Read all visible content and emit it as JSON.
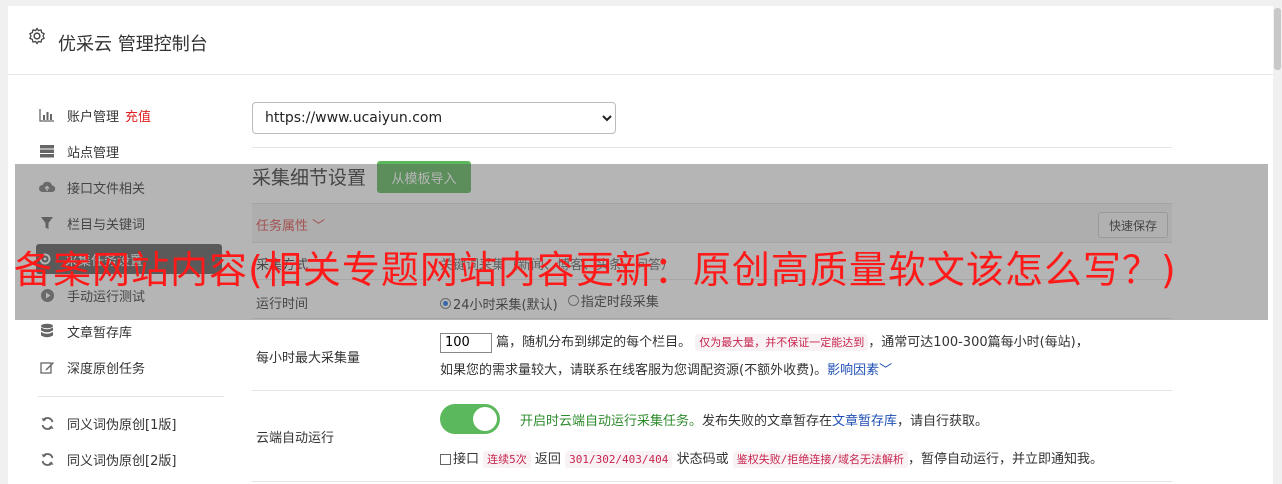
{
  "header": {
    "title": "优采云 管理控制台",
    "icon": "gear-icon"
  },
  "sidebar": {
    "items": [
      {
        "label": "账户管理",
        "icon": "bar-chart-icon",
        "badge": "充值"
      },
      {
        "label": "站点管理",
        "icon": "server-icon"
      },
      {
        "label": "接口文件相关",
        "icon": "cloud-upload-icon"
      },
      {
        "label": "栏目与关键词",
        "icon": "filter-icon"
      },
      {
        "label": "采集任务设置",
        "icon": "settings-icon",
        "active": true
      },
      {
        "label": "手动运行测试",
        "icon": "play-circle-icon"
      },
      {
        "label": "文章暂存库",
        "icon": "database-icon"
      },
      {
        "label": "深度原创任务",
        "icon": "edit-icon"
      },
      {
        "label": "同义词伪原创[1版]",
        "icon": "refresh-icon"
      },
      {
        "label": "同义词伪原创[2版]",
        "icon": "refresh-icon"
      }
    ]
  },
  "site_select": {
    "value": "https://www.ucaiyun.com"
  },
  "section": {
    "title": "采集细节设置",
    "import_button": "从模板导入",
    "props_title": "任务属性",
    "quick_save": "快速保存"
  },
  "rows": {
    "mode_label": "采集方式",
    "mode_text": "关键词采集（新闻、博客、头条、问答）",
    "run_time_label": "运行时间",
    "run_time_opt1": "24小时采集(默认)",
    "run_time_opt2": "指定时段采集",
    "max_label": "每小时最大采集量",
    "max_value": "100",
    "max_text1": "篇，随机分布到绑定的每个栏目。",
    "max_tag": "仅为最大量，并不保证一定能达到",
    "max_text2": "，通常可达100-300篇每小时(每站)，",
    "max_text3": "如果您的需求量较大，请联系在线客服为您调配资源(不额外收费)。",
    "max_link": "影响因素",
    "auto_label": "云端自动运行",
    "auto_text1": "开启时云端自动运行采集任务。",
    "auto_text2": "发布失败的文章暂存在",
    "auto_link": "文章暂存库",
    "auto_text3": "，请自行获取。",
    "auto_cb_text1": "接口",
    "auto_tag1": "连续5次",
    "auto_cb_text2": "返回",
    "auto_tag2": "301/302/403/404",
    "auto_cb_text3": "状态码或",
    "auto_tag3": "鉴权失败/拒绝连接/域名无法解析",
    "auto_cb_text4": "，暂停自动运行，并立即通知我。"
  },
  "overlay": {
    "text": "备案网站内容(相关专题网站内容更新：原创高质量软文该怎么写？)"
  },
  "colors": {
    "accent_green": "#5cb85c",
    "recharge_red": "#e02020",
    "overlay_red": "#ff1a1a"
  }
}
